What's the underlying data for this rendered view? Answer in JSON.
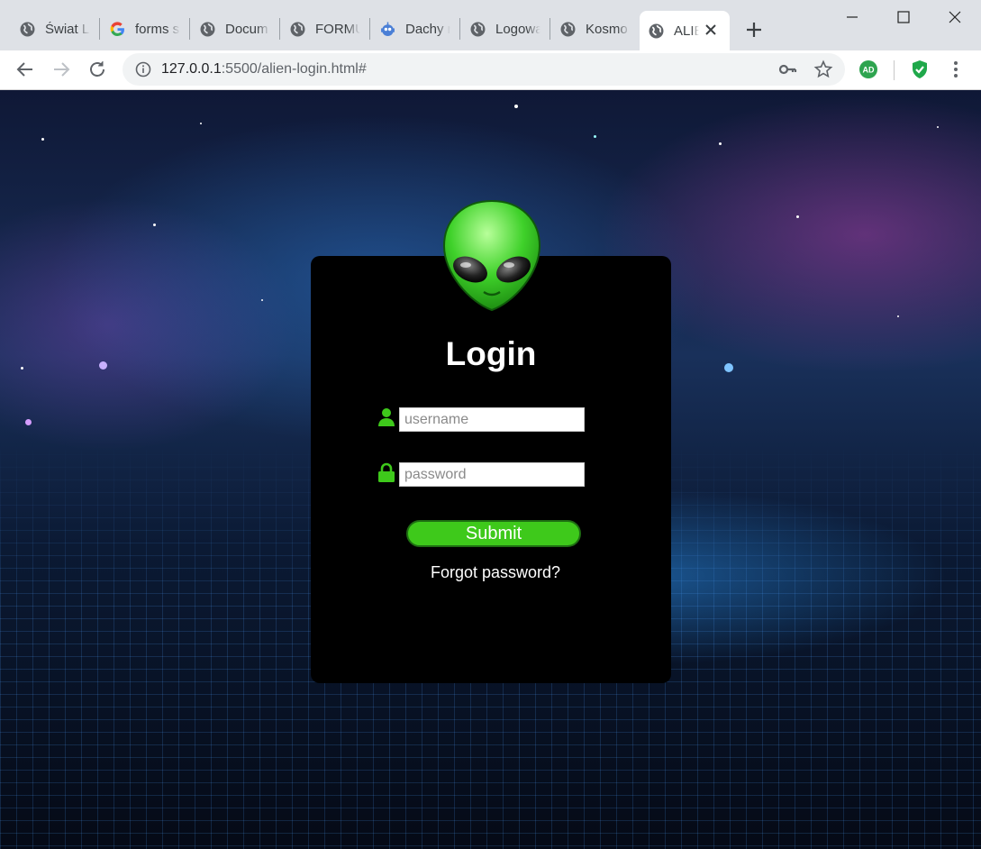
{
  "browser": {
    "tabs": [
      {
        "title": "Świat LI",
        "icon": "globe-icon"
      },
      {
        "title": "forms s",
        "icon": "google-icon"
      },
      {
        "title": "Docum",
        "icon": "globe-icon"
      },
      {
        "title": "FORMU",
        "icon": "globe-icon"
      },
      {
        "title": "Dachy r",
        "icon": "robot-icon"
      },
      {
        "title": "Logowa",
        "icon": "globe-icon"
      },
      {
        "title": "Kosmo",
        "icon": "globe-icon"
      },
      {
        "title": "ALIE",
        "icon": "globe-icon",
        "active": true
      }
    ],
    "url_host": "127.0.0.1",
    "url_rest": ":5500/alien-login.html#",
    "extension_badge": "AD"
  },
  "login": {
    "title": "Login",
    "username_placeholder": "username",
    "password_placeholder": "password",
    "submit_label": "Submit",
    "forgot_label": "Forgot password?",
    "accent_color": "#3ec91b"
  }
}
